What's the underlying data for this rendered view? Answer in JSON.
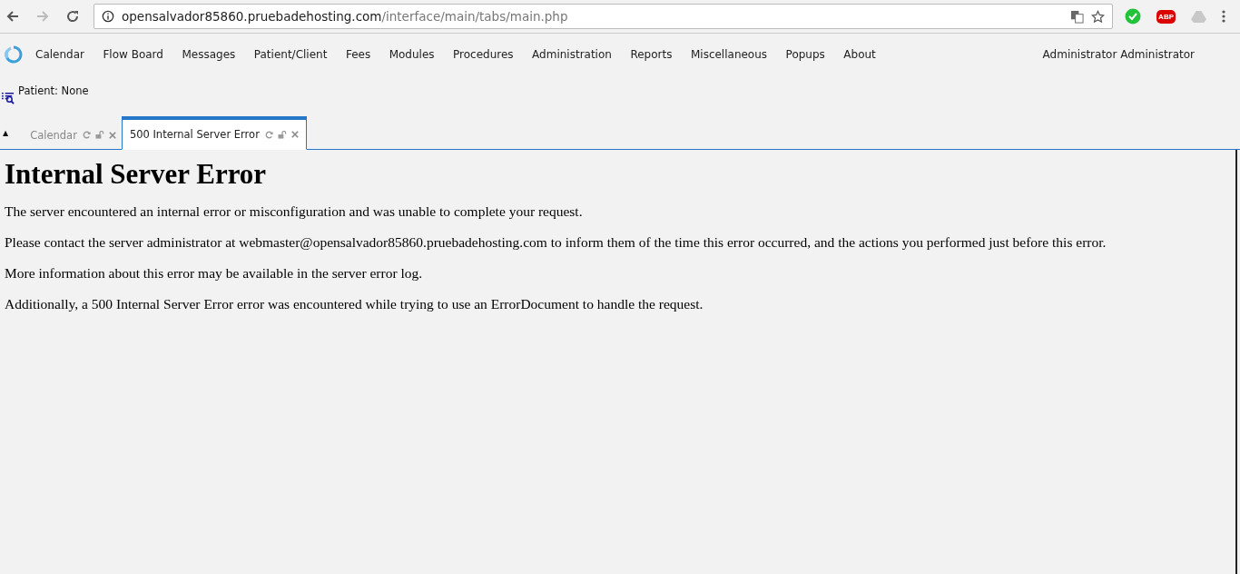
{
  "browser": {
    "url_host": "opensalvador85860.pruebadehosting.com",
    "url_path": "/interface/main/tabs/main.php",
    "extension_badge": "ABP"
  },
  "menu": {
    "items": [
      "Calendar",
      "Flow Board",
      "Messages",
      "Patient/Client",
      "Fees",
      "Modules",
      "Procedures",
      "Administration",
      "Reports",
      "Miscellaneous",
      "Popups",
      "About"
    ],
    "user": "Administrator Administrator"
  },
  "patient": {
    "label": "Patient: None"
  },
  "collapse_toggle": "▲",
  "tabs": [
    {
      "label": "Calendar",
      "selected": false
    },
    {
      "label": "500 Internal Server Error",
      "selected": true
    }
  ],
  "content": {
    "heading": "Internal Server Error",
    "paragraphs": [
      "The server encountered an internal error or misconfiguration and was unable to complete your request.",
      "Please contact the server administrator at webmaster@opensalvador85860.pruebadehosting.com to inform them of the time this error occurred, and the actions you performed just before this error.",
      "More information about this error may be available in the server error log.",
      "Additionally, a 500 Internal Server Error error was encountered while trying to use an ErrorDocument to handle the request."
    ]
  }
}
